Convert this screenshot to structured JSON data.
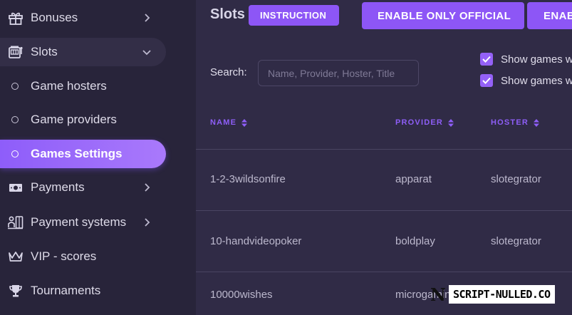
{
  "sidebar": {
    "items": [
      {
        "label": "Bonuses",
        "icon": "gift-icon",
        "has_chevron": true,
        "state": "collapsed"
      },
      {
        "label": "Slots",
        "icon": "slot-machine-icon",
        "has_chevron": true,
        "state": "expanded"
      },
      {
        "label": "Game hosters",
        "icon": "circle-icon",
        "sub": true
      },
      {
        "label": "Game providers",
        "icon": "circle-icon",
        "sub": true
      },
      {
        "label": "Games Settings",
        "icon": "circle-icon",
        "sub": true,
        "active": true
      },
      {
        "label": "Payments",
        "icon": "banknote-icon",
        "has_chevron": true
      },
      {
        "label": "Payment systems",
        "icon": "payment-systems-icon",
        "has_chevron": true
      },
      {
        "label": "VIP - scores",
        "icon": "crown-icon"
      },
      {
        "label": "Tournaments",
        "icon": "trophy-icon"
      }
    ]
  },
  "header": {
    "title": "Slots",
    "instruction_label": "INSTRUCTION",
    "enable_official_label": "ENABLE ONLY OFFICIAL",
    "enable_label": "ENAB"
  },
  "search": {
    "label": "Search:",
    "placeholder": "Name, Provider, Hoster, Title",
    "value": ""
  },
  "filters": [
    {
      "label": "Show games w",
      "checked": true
    },
    {
      "label": "Show games w",
      "checked": true
    }
  ],
  "table": {
    "columns": [
      "NAME",
      "PROVIDER",
      "HOSTER"
    ],
    "rows": [
      [
        "1-2-3wildsonfire",
        "apparat",
        "slotegrator"
      ],
      [
        "10-handvideopoker",
        "boldplay",
        "slotegrator"
      ],
      [
        "10000wishes",
        "microgaming",
        ""
      ]
    ]
  },
  "watermark": {
    "logo_letter": "N",
    "text": "SCRIPT-NULLED.CO"
  },
  "colors": {
    "accent": "#8d56f6",
    "sidebar_bg": "#28243a",
    "main_bg": "#302b46",
    "active_gradient_start": "#8e5dfa",
    "active_gradient_end": "#a979fb"
  }
}
